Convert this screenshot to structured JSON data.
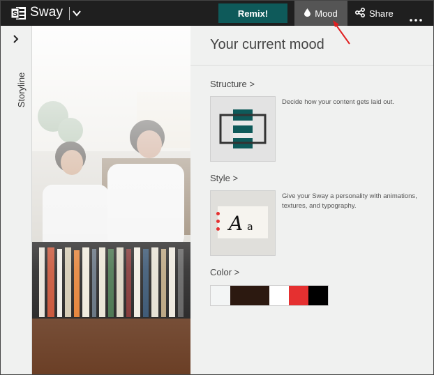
{
  "app": {
    "name": "Sway"
  },
  "toolbar": {
    "remix_label": "Remix!",
    "mood_label": "Mood",
    "share_label": "Share"
  },
  "sidebar": {
    "storyline_label": "Storyline"
  },
  "mood_panel": {
    "title": "Your current mood",
    "structure": {
      "heading": "Structure >",
      "description": "Decide how your content gets laid out."
    },
    "style": {
      "heading": "Style >",
      "description": "Give your Sway a personality with animations, textures, and typography.",
      "sample_text_large": "A",
      "sample_text_small": "a"
    },
    "color": {
      "heading": "Color >",
      "palette": [
        "#f3f5f5",
        "#2c1910",
        "#2c1910",
        "#ffffff",
        "#e53030",
        "#000000"
      ]
    }
  },
  "colors": {
    "topbar": "#1f1f1f",
    "remix": "#0e5a5a",
    "mood_active": "#555555",
    "annotation_arrow": "#e02020"
  }
}
